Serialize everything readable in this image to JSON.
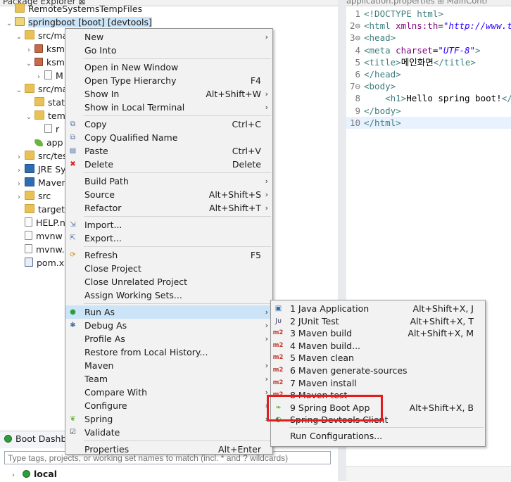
{
  "package_explorer": {
    "title": "Package Explorer ⊠",
    "tree": [
      {
        "label": "RemoteSystemsTempFiles",
        "icon": "folder-icon"
      },
      {
        "label": "springboot [boot] [devtools]",
        "icon": "project-icon"
      },
      {
        "label": "src/ma",
        "icon": "source-folder-icon"
      },
      {
        "label": "ksm",
        "icon": "package-icon"
      },
      {
        "label": "ksm",
        "icon": "package-icon"
      },
      {
        "label": "M",
        "icon": "java-file-icon"
      },
      {
        "label": "src/ma",
        "icon": "source-folder-icon"
      },
      {
        "label": "stat",
        "icon": "folder-icon"
      },
      {
        "label": "tem",
        "icon": "folder-icon"
      },
      {
        "label": "r",
        "icon": "file-icon"
      },
      {
        "label": "app",
        "icon": "spring-file-icon"
      },
      {
        "label": "src/test",
        "icon": "source-folder-icon"
      },
      {
        "label": "JRE Sy",
        "icon": "library-icon"
      },
      {
        "label": "Maven",
        "icon": "library-icon"
      },
      {
        "label": "src",
        "icon": "folder-icon"
      },
      {
        "label": "target",
        "icon": "folder-icon"
      },
      {
        "label": "HELP.n",
        "icon": "file-icon"
      },
      {
        "label": "mvnw",
        "icon": "file-icon"
      },
      {
        "label": "mvnw.",
        "icon": "file-icon"
      },
      {
        "label": "pom.xr",
        "icon": "maven-pom-icon"
      }
    ]
  },
  "boot_dashboard": {
    "title": "Boot Dashbo",
    "filter_placeholder": "Type tags, projects, or working set names to match (incl. * and ? wildcards)",
    "local_label": "local"
  },
  "editor": {
    "tabs": "application.properties   ⊞ MainContr",
    "lines": [
      {
        "n": "1",
        "parts": [
          [
            "tag",
            "<!DOCTYPE html>"
          ]
        ]
      },
      {
        "n": "2⊖",
        "parts": [
          [
            "tag",
            "<html "
          ],
          [
            "attr",
            "xmlns:th"
          ],
          [
            "txt",
            "="
          ],
          [
            "str",
            "\"http://www.th"
          ]
        ]
      },
      {
        "n": "3⊖",
        "parts": [
          [
            "tag",
            "<head>"
          ]
        ]
      },
      {
        "n": "4",
        "parts": [
          [
            "tag",
            "<meta "
          ],
          [
            "attr",
            "charset"
          ],
          [
            "txt",
            "="
          ],
          [
            "str",
            "\"UTF-8\""
          ],
          [
            "tag",
            ">"
          ]
        ]
      },
      {
        "n": "5",
        "parts": [
          [
            "tag",
            "<title>"
          ],
          [
            "txt",
            "메인화면"
          ],
          [
            "tag",
            "</title>"
          ]
        ]
      },
      {
        "n": "6",
        "parts": [
          [
            "tag",
            "</head>"
          ]
        ]
      },
      {
        "n": "7⊖",
        "parts": [
          [
            "tag",
            "<body>"
          ]
        ]
      },
      {
        "n": "8",
        "parts": [
          [
            "txt",
            "    "
          ],
          [
            "tag",
            "<h1>"
          ],
          [
            "txt",
            "Hello spring boot!"
          ],
          [
            "tag",
            "</h"
          ]
        ]
      },
      {
        "n": "9",
        "parts": [
          [
            "tag",
            "</body>"
          ]
        ]
      },
      {
        "n": "10",
        "parts": [
          [
            "tag",
            "</html>"
          ]
        ]
      }
    ]
  },
  "context_menu": [
    {
      "label": "New",
      "shortcut": "",
      "submenu": true
    },
    {
      "label": "Go Into",
      "shortcut": ""
    },
    {
      "sep": true
    },
    {
      "label": "Open in New Window",
      "shortcut": ""
    },
    {
      "label": "Open Type Hierarchy",
      "shortcut": "F4"
    },
    {
      "label": "Show In",
      "shortcut": "Alt+Shift+W",
      "submenu": true
    },
    {
      "label": "Show in Local Terminal",
      "shortcut": "",
      "submenu": true
    },
    {
      "sep": true
    },
    {
      "label": "Copy",
      "shortcut": "Ctrl+C",
      "icon": "copy-icon"
    },
    {
      "label": "Copy Qualified Name",
      "shortcut": "",
      "icon": "copy-qualified-icon"
    },
    {
      "label": "Paste",
      "shortcut": "Ctrl+V",
      "icon": "paste-icon"
    },
    {
      "label": "Delete",
      "shortcut": "Delete",
      "icon": "delete-icon"
    },
    {
      "sep": true
    },
    {
      "label": "Build Path",
      "shortcut": "",
      "submenu": true
    },
    {
      "label": "Source",
      "shortcut": "Alt+Shift+S",
      "submenu": true
    },
    {
      "label": "Refactor",
      "shortcut": "Alt+Shift+T",
      "submenu": true
    },
    {
      "sep": true
    },
    {
      "label": "Import...",
      "shortcut": "",
      "icon": "import-icon"
    },
    {
      "label": "Export...",
      "shortcut": "",
      "icon": "export-icon"
    },
    {
      "sep": true
    },
    {
      "label": "Refresh",
      "shortcut": "F5",
      "icon": "refresh-icon"
    },
    {
      "label": "Close Project",
      "shortcut": ""
    },
    {
      "label": "Close Unrelated Project",
      "shortcut": ""
    },
    {
      "label": "Assign Working Sets...",
      "shortcut": ""
    },
    {
      "sep": true
    },
    {
      "label": "Run As",
      "shortcut": "",
      "submenu": true,
      "selected": true,
      "icon": "run-icon"
    },
    {
      "label": "Debug As",
      "shortcut": "",
      "submenu": true,
      "icon": "debug-icon"
    },
    {
      "label": "Profile As",
      "shortcut": "",
      "submenu": true
    },
    {
      "label": "Restore from Local History...",
      "shortcut": ""
    },
    {
      "label": "Maven",
      "shortcut": "",
      "submenu": true
    },
    {
      "label": "Team",
      "shortcut": "",
      "submenu": true
    },
    {
      "label": "Compare With",
      "shortcut": "",
      "submenu": true
    },
    {
      "label": "Configure",
      "shortcut": "",
      "submenu": true
    },
    {
      "label": "Spring",
      "shortcut": "",
      "submenu": true,
      "icon": "spring-icon"
    },
    {
      "label": "Validate",
      "shortcut": "",
      "icon": "validate-icon"
    },
    {
      "sep": true
    },
    {
      "label": "Properties",
      "shortcut": "Alt+Enter"
    }
  ],
  "run_as_menu": [
    {
      "label": "1 Java Application",
      "shortcut": "Alt+Shift+X, J",
      "icon": "java-app-icon"
    },
    {
      "label": "2 JUnit Test",
      "shortcut": "Alt+Shift+X, T",
      "icon": "junit-icon"
    },
    {
      "label": "3 Maven build",
      "shortcut": "Alt+Shift+X, M",
      "icon": "maven-icon"
    },
    {
      "label": "4 Maven build...",
      "shortcut": "",
      "icon": "maven-icon"
    },
    {
      "label": "5 Maven clean",
      "shortcut": "",
      "icon": "maven-icon"
    },
    {
      "label": "6 Maven generate-sources",
      "shortcut": "",
      "icon": "maven-icon"
    },
    {
      "label": "7 Maven install",
      "shortcut": "",
      "icon": "maven-icon"
    },
    {
      "label": "8 Maven test",
      "shortcut": "",
      "icon": "maven-icon"
    },
    {
      "label": "9 Spring Boot App",
      "shortcut": "Alt+Shift+X, B",
      "icon": "spring-boot-icon"
    },
    {
      "label": "Spring Devtools Client",
      "shortcut": "",
      "icon": "devtools-icon"
    },
    {
      "sep": true
    },
    {
      "label": "Run Configurations...",
      "shortcut": ""
    }
  ],
  "colors": {
    "highlight": "#e21d1d",
    "menu_bg": "#f2f2f2",
    "selected": "#cce4f7",
    "maven_icon": "#c23b2e"
  }
}
